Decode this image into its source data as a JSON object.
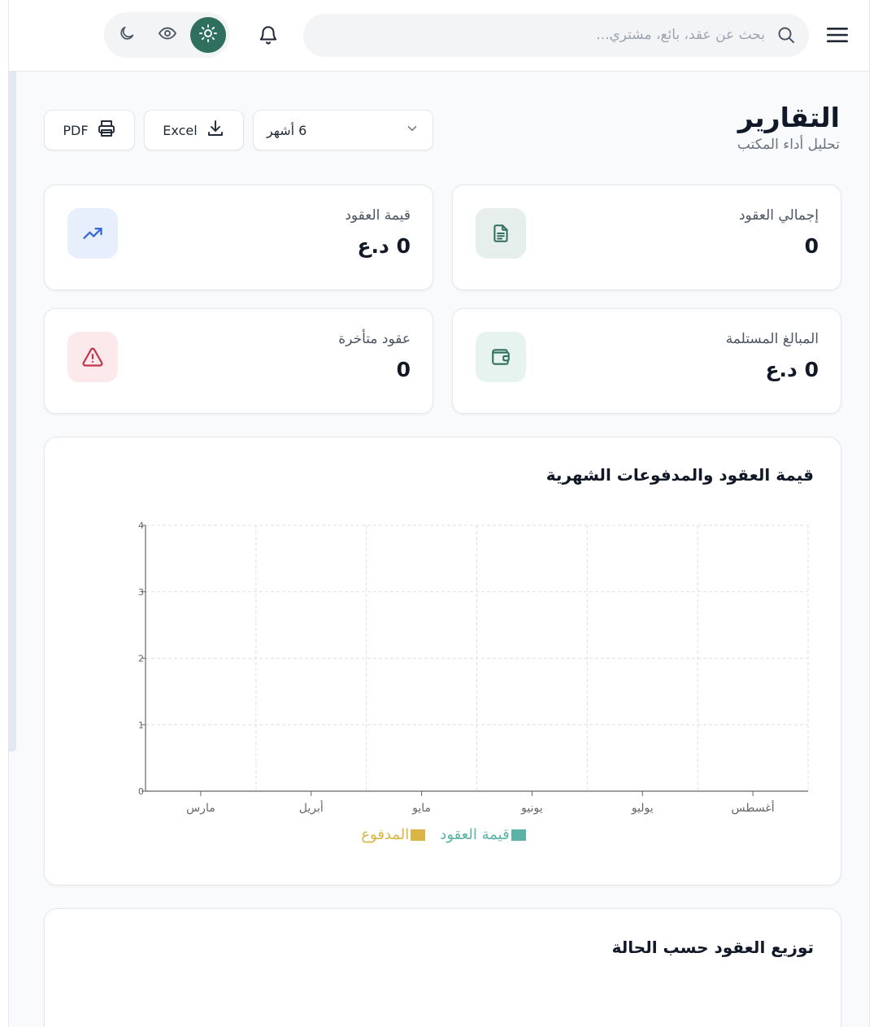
{
  "header": {
    "search_placeholder": "بحث عن عقد، بائع، مشتري...",
    "theme_options": [
      "dark",
      "eye",
      "light"
    ],
    "active_theme": "light"
  },
  "page": {
    "title": "التقارير",
    "subtitle": "تحليل أداء المكتب"
  },
  "controls": {
    "pdf_label": "PDF",
    "excel_label": "Excel",
    "period_value": "6 أشهر"
  },
  "stats": {
    "total_contracts": {
      "label": "إجمالي العقود",
      "value": "0"
    },
    "contracts_value": {
      "label": "قيمة العقود",
      "value": "0 د.ع"
    },
    "received_amounts": {
      "label": "المبالغ المستلمة",
      "value": "0 د.ع"
    },
    "late_contracts": {
      "label": "عقود متأخرة",
      "value": "0"
    }
  },
  "colors": {
    "accent": "#2f6f5e",
    "contract_value_series": "#5ab3a4",
    "paid_series": "#d9b545"
  },
  "chart_data": {
    "type": "bar",
    "title": "قيمة العقود والمدفوعات الشهرية",
    "categories": [
      "مارس",
      "أبريل",
      "مايو",
      "يونيو",
      "يوليو",
      "أغسطس"
    ],
    "series": [
      {
        "name": "قيمة العقود",
        "values": [
          0,
          0,
          0,
          0,
          0,
          0
        ]
      },
      {
        "name": "المدفوع",
        "values": [
          0,
          0,
          0,
          0,
          0,
          0
        ]
      }
    ],
    "y_ticks": [
      "0",
      "1",
      "2",
      "3",
      "4"
    ],
    "ylim": [
      0,
      4
    ],
    "grid": true,
    "legend": "bottom"
  },
  "status_chart": {
    "title": "توزيع العقود حسب الحالة"
  }
}
